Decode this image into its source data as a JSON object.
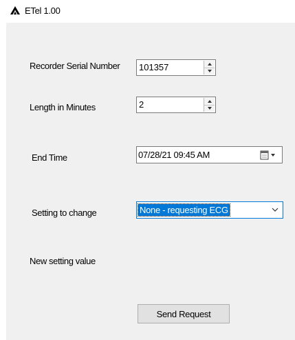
{
  "window": {
    "title": "ETel 1.00"
  },
  "form": {
    "serial_label": "Recorder Serial Number",
    "serial_value": "101357",
    "length_label": "Length in Minutes",
    "length_value": "2",
    "end_time_label": "End Time",
    "end_time_value": "07/28/21 09:45 AM",
    "setting_label": "Setting to change",
    "setting_value": "None - requesting ECG",
    "new_value_label": "New setting value",
    "send_label": "Send Request"
  },
  "icons": {
    "app": "app-logo-icon",
    "spin_up": "spin-up-icon",
    "spin_down": "spin-down-icon",
    "calendar": "calendar-icon",
    "dropdown": "chevron-down-icon"
  },
  "colors": {
    "selection": "#0078d7",
    "panel": "#f0f0f0",
    "button": "#e1e1e1"
  }
}
